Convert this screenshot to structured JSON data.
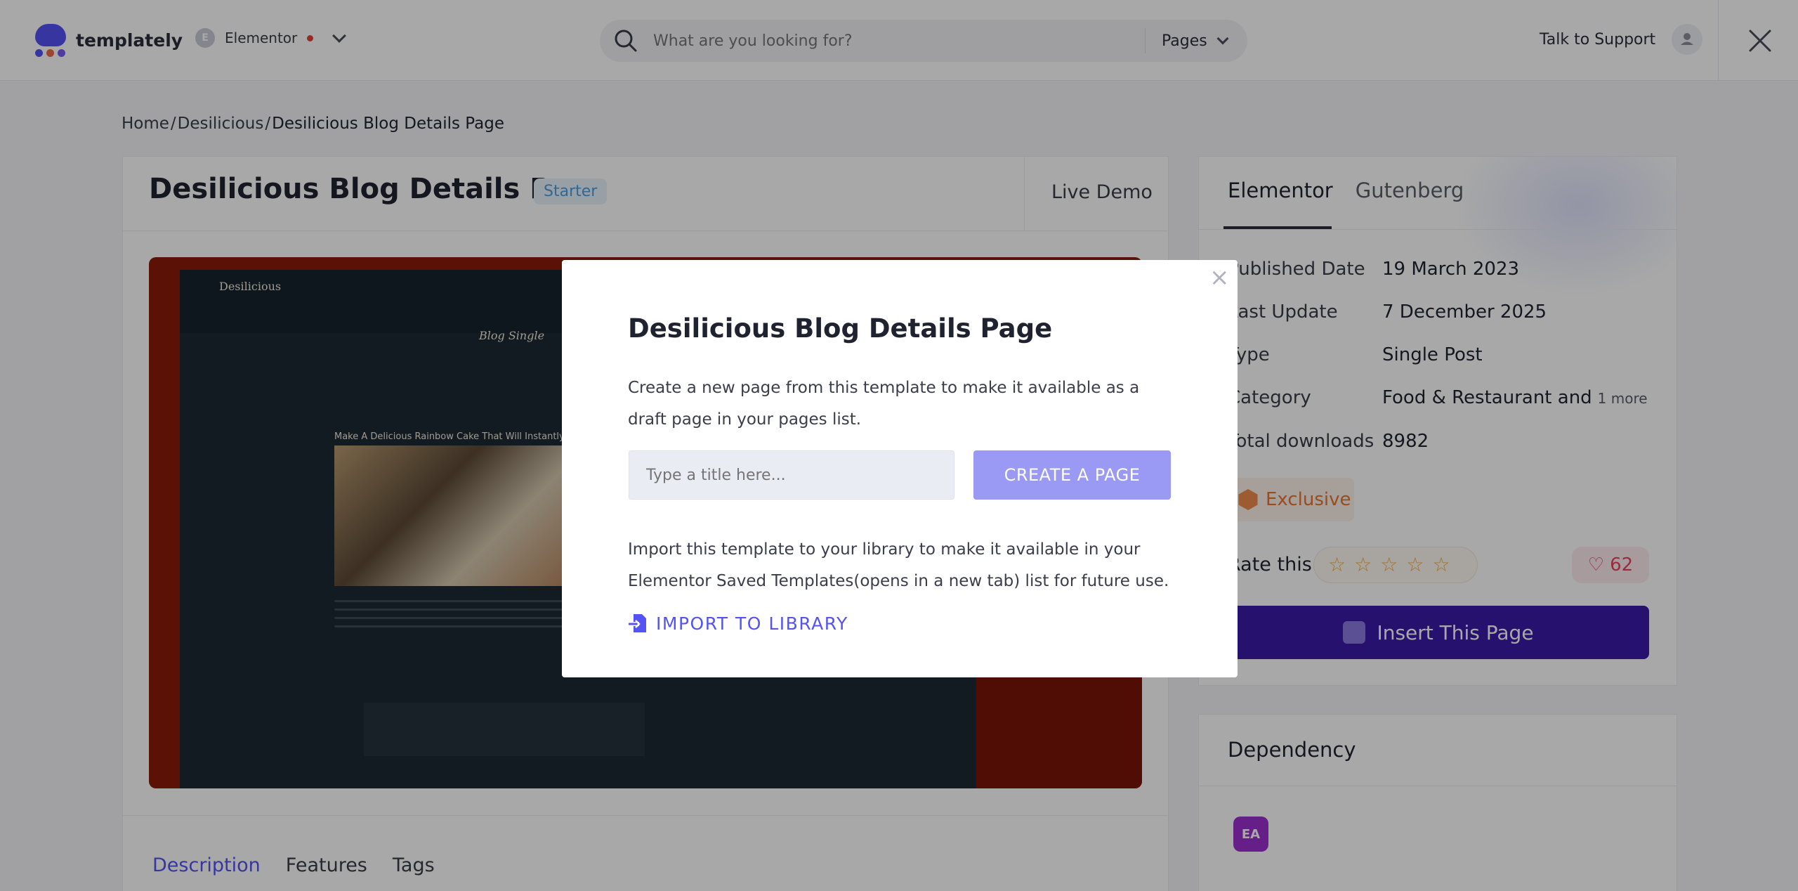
{
  "header": {
    "brand": "templately",
    "builder": "Elementor",
    "search_placeholder": "What are you looking for?",
    "search_scope": "Pages",
    "support": "Talk to Support"
  },
  "breadcrumb": {
    "home": "Home",
    "sep": "/",
    "parent": "Desilicious",
    "current": "Desilicious Blog Details Page"
  },
  "page": {
    "title": "Desilicious Blog Details Page",
    "badge": "Starter",
    "live_demo": "Live Demo"
  },
  "preview": {
    "logo": "Desilicious",
    "hero_title": "Blog Single",
    "post_heading": "Make A Delicious Rainbow Cake That Will Instantly Win Hearts"
  },
  "bottom_tabs": [
    "Description",
    "Features",
    "Tags"
  ],
  "side": {
    "tabs": [
      "Elementor",
      "Gutenberg"
    ],
    "info": [
      {
        "k": "Published Date",
        "v": "19 March 2023"
      },
      {
        "k": "Last Update",
        "v": "7 December 2025"
      },
      {
        "k": "Type",
        "v": "Single Post"
      },
      {
        "k": "Category",
        "v": "Food & Restaurant and",
        "more": "1 more"
      },
      {
        "k": "Total downloads",
        "v": "8982"
      }
    ],
    "exclusive": "Exclusive",
    "rate_label": "Rate this",
    "likes": "62",
    "insert_label": "Insert This Page",
    "dependency_title": "Dependency"
  },
  "modal": {
    "title": "Desilicious Blog Details Page",
    "description": "Create a new page from this template to make it available as a draft page in your pages list.",
    "input_placeholder": "Type a title here...",
    "create_label": "CREATE A PAGE",
    "import_text": "Import this template to your library to make it available in your Elementor Saved Templates(opens in a new tab) list for future use.",
    "import_label": "IMPORT TO LIBRARY",
    "close": "×"
  },
  "colors": {
    "accent": "#5453f4",
    "primary_button": "#3b1aa8",
    "create_button": "#9a99f3",
    "exclusive": "#e8742f"
  }
}
